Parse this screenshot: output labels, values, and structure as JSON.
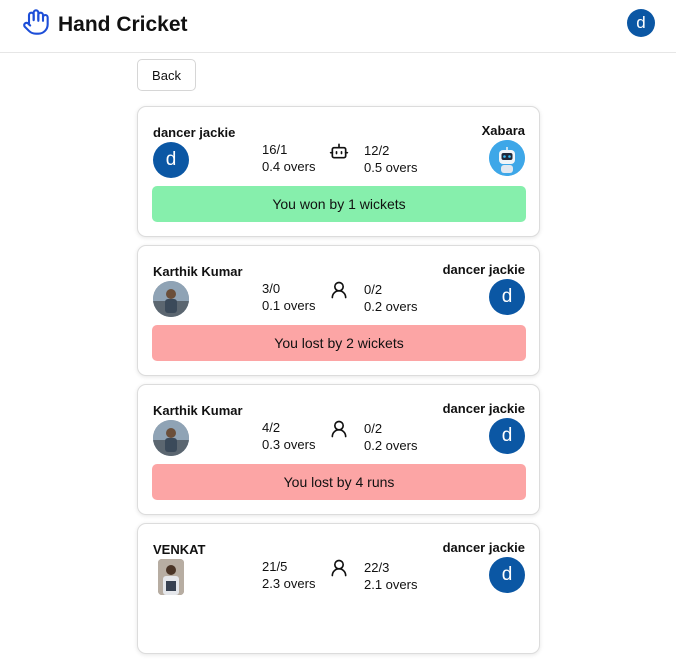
{
  "app": {
    "title": "Hand Cricket",
    "user_initial": "d"
  },
  "nav": {
    "back_label": "Back"
  },
  "matches": [
    {
      "left": {
        "name": "dancer jackie",
        "avatar": "d",
        "score": "16/1",
        "overs": "0.4 overs"
      },
      "right": {
        "name": "Xabara",
        "avatar": "robot-avatar",
        "score": "12/2",
        "overs": "0.5 overs"
      },
      "mode_icon": "robot-icon",
      "result": "You won by 1 wickets",
      "outcome": "won"
    },
    {
      "left": {
        "name": "Karthik Kumar",
        "avatar": "photo",
        "score": "3/0",
        "overs": "0.1 overs"
      },
      "right": {
        "name": "dancer jackie",
        "avatar": "d",
        "score": "0/2",
        "overs": "0.2 overs"
      },
      "mode_icon": "person-icon",
      "result": "You lost by 2 wickets",
      "outcome": "lost"
    },
    {
      "left": {
        "name": "Karthik Kumar",
        "avatar": "photo",
        "score": "4/2",
        "overs": "0.3 overs"
      },
      "right": {
        "name": "dancer jackie",
        "avatar": "d",
        "score": "0/2",
        "overs": "0.2 overs"
      },
      "mode_icon": "person-icon",
      "result": "You lost by 4 runs",
      "outcome": "lost"
    },
    {
      "left": {
        "name": "VENKAT",
        "avatar": "photo",
        "score": "21/5",
        "overs": "2.3 overs"
      },
      "right": {
        "name": "dancer jackie",
        "avatar": "d",
        "score": "22/3",
        "overs": "2.1 overs"
      },
      "mode_icon": "person-icon",
      "result": "",
      "outcome": ""
    }
  ],
  "colors": {
    "accent": "#0b57a4",
    "won": "#86efac",
    "lost": "#fca5a5",
    "robot_bg": "#3ea7e8"
  }
}
